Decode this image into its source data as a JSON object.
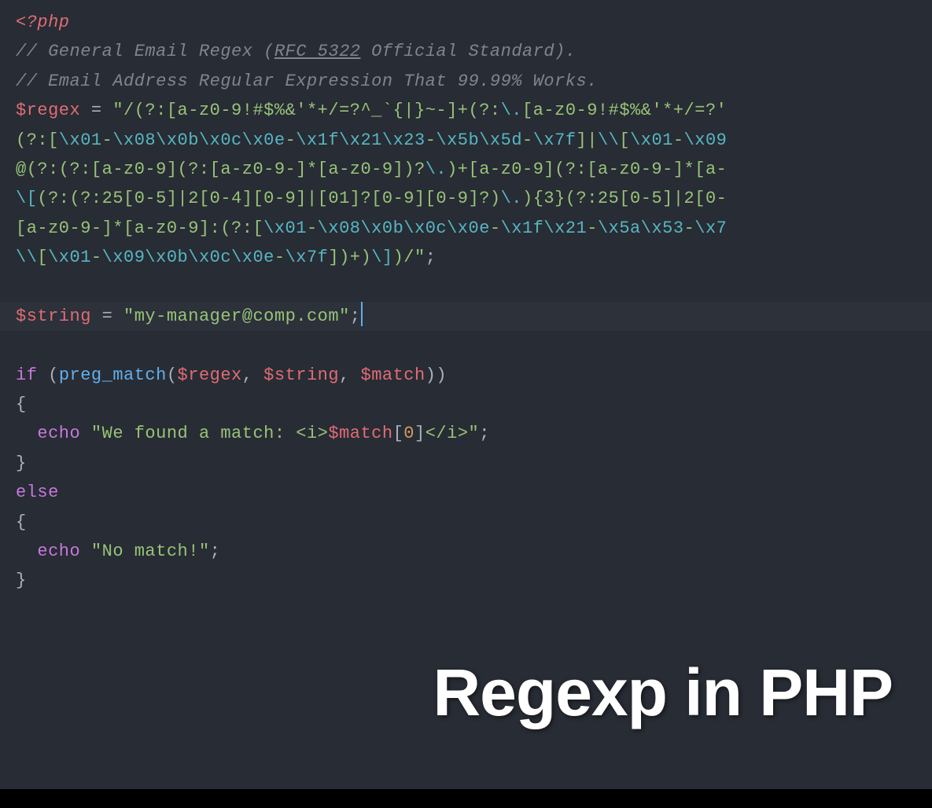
{
  "code": {
    "php_open": "<?php",
    "comment1_prefix": "// General Email Regex (",
    "comment1_rfc": "RFC 5322",
    "comment1_suffix": " Official Standard).",
    "comment2": "// Email Address Regular Expression That 99.99% Works.",
    "var_regex": "$regex",
    "eq": " = ",
    "regex_line1_a": "\"/(?:[a-z0-9!#$%&'*+/=?^_`{|}~-]+(?:",
    "regex_line1_esc1": "\\.",
    "regex_line1_b": "[a-z0-9!#$%&'*+/=?'",
    "regex_line2_a": "(?:[",
    "regex_line2_e1": "\\x01",
    "regex_line2_a2": "-",
    "regex_line2_e2": "\\x08\\x0b\\x0c\\x0e",
    "regex_line2_a3": "-",
    "regex_line2_e3": "\\x1f\\x21\\x23",
    "regex_line2_a4": "-",
    "regex_line2_e4": "\\x5b\\x5d",
    "regex_line2_a5": "-",
    "regex_line2_e5": "\\x7f",
    "regex_line2_a6": "]|",
    "regex_line2_e6": "\\\\",
    "regex_line2_a7": "[",
    "regex_line2_e7": "\\x01",
    "regex_line2_a8": "-",
    "regex_line2_e8": "\\x09",
    "regex_line3_a": "@(?:(?:[a-z0-9](?:[a-z0-9-]*[a-z0-9])?",
    "regex_line3_e1": "\\.",
    "regex_line3_b": ")+[a-z0-9](?:[a-z0-9-]*[a-",
    "regex_line4_e1": "\\[",
    "regex_line4_a": "(?:(?:25[0-5]|2[0-4][0-9]|[01]?[0-9][0-9]?)",
    "regex_line4_e2": "\\.",
    "regex_line4_b": "){3}(?:25[0-5]|2[0-",
    "regex_line5_a": "[a-z0-9-]*[a-z0-9]:(?:[",
    "regex_line5_e1": "\\x01",
    "regex_line5_a2": "-",
    "regex_line5_e2": "\\x08\\x0b\\x0c\\x0e",
    "regex_line5_a3": "-",
    "regex_line5_e3": "\\x1f\\x21",
    "regex_line5_a4": "-",
    "regex_line5_e4": "\\x5a\\x53",
    "regex_line5_a5": "-",
    "regex_line5_e5": "\\x7",
    "regex_line6_e1": "\\\\",
    "regex_line6_a1": "[",
    "regex_line6_e2": "\\x01",
    "regex_line6_a2": "-",
    "regex_line6_e3": "\\x09\\x0b\\x0c\\x0e",
    "regex_line6_a3": "-",
    "regex_line6_e4": "\\x7f",
    "regex_line6_a4": "])+)",
    "regex_line6_e5": "\\]",
    "regex_line6_a5": ")/\"",
    "semi": ";",
    "var_string": "$string",
    "string_val": "\"my-manager@comp.com\"",
    "if_kw": "if",
    "preg_match": "preg_match",
    "var_match": "$match",
    "paren_open": "(",
    "paren_close": ")",
    "comma": ", ",
    "brace_open": "{",
    "brace_close": "}",
    "echo_kw": "echo",
    "echo1_str1": "\"We found a match: <i>",
    "echo1_var": "$match",
    "echo1_idx_open": "[",
    "echo1_idx_num": "0",
    "echo1_idx_close": "]",
    "echo1_str2": "</i>\"",
    "else_kw": "else",
    "echo2_str": "\"No match!\"",
    "indent": "  "
  },
  "overlay": {
    "title": "Regexp in PHP"
  }
}
